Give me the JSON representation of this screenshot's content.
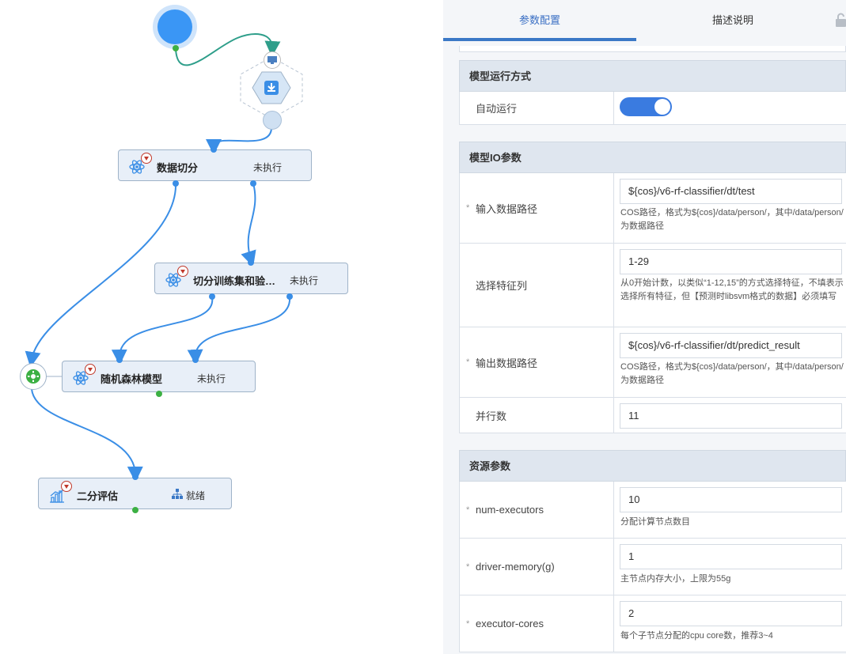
{
  "canvas": {
    "nodes": [
      {
        "id": "split",
        "title": "数据切分",
        "status": "未执行",
        "icon": "atom-icon"
      },
      {
        "id": "trainval",
        "title": "切分训练集和验…",
        "status": "未执行",
        "icon": "atom-icon"
      },
      {
        "id": "rf",
        "title": "随机森林模型",
        "status": "未执行",
        "icon": "atom-icon"
      },
      {
        "id": "eval",
        "title": "二分评估",
        "status": "就绪",
        "icon": "bar-chart-icon"
      }
    ]
  },
  "panel": {
    "tabs": [
      "参数配置",
      "描述说明"
    ],
    "active_tab": "参数配置",
    "sections": {
      "run_mode": {
        "title": "模型运行方式",
        "auto_run_label": "自动运行",
        "auto_run": true
      },
      "io": {
        "title": "模型IO参数",
        "input_path_label": "输入数据路径",
        "input_path": "${cos}/v6-rf-classifier/dt/test",
        "input_path_hint": "COS路径，格式为${cos}/data/person/，其中/data/person/为数据路径",
        "features_label": "选择特征列",
        "features": "1-29",
        "features_hint": "从0开始计数，以类似“1-12,15”的方式选择特征，不填表示选择所有特征，但【预测时libsvm格式的数据】必须填写",
        "output_path_label": "输出数据路径",
        "output_path": "${cos}/v6-rf-classifier/dt/predict_result",
        "output_path_hint": "COS路径，格式为${cos}/data/person/，其中/data/person/为数据路径",
        "parallel_label": "并行数",
        "parallel": "11"
      },
      "resources": {
        "title": "资源参数",
        "num_executors_label": "num-executors",
        "num_executors": "10",
        "num_executors_hint": "分配计算节点数目",
        "driver_memory_label": "driver-memory(g)",
        "driver_memory": "1",
        "driver_memory_hint": "主节点内存大小，上限为55g",
        "executor_cores_label": "executor-cores",
        "executor_cores": "2",
        "executor_cores_hint": "每个子节点分配的cpu core数，推荐3~4"
      }
    }
  },
  "colors": {
    "accent": "#3a7be0",
    "edge": "#3a8ee6",
    "start_node": "#3a96f5",
    "green_port": "#3cb043"
  }
}
